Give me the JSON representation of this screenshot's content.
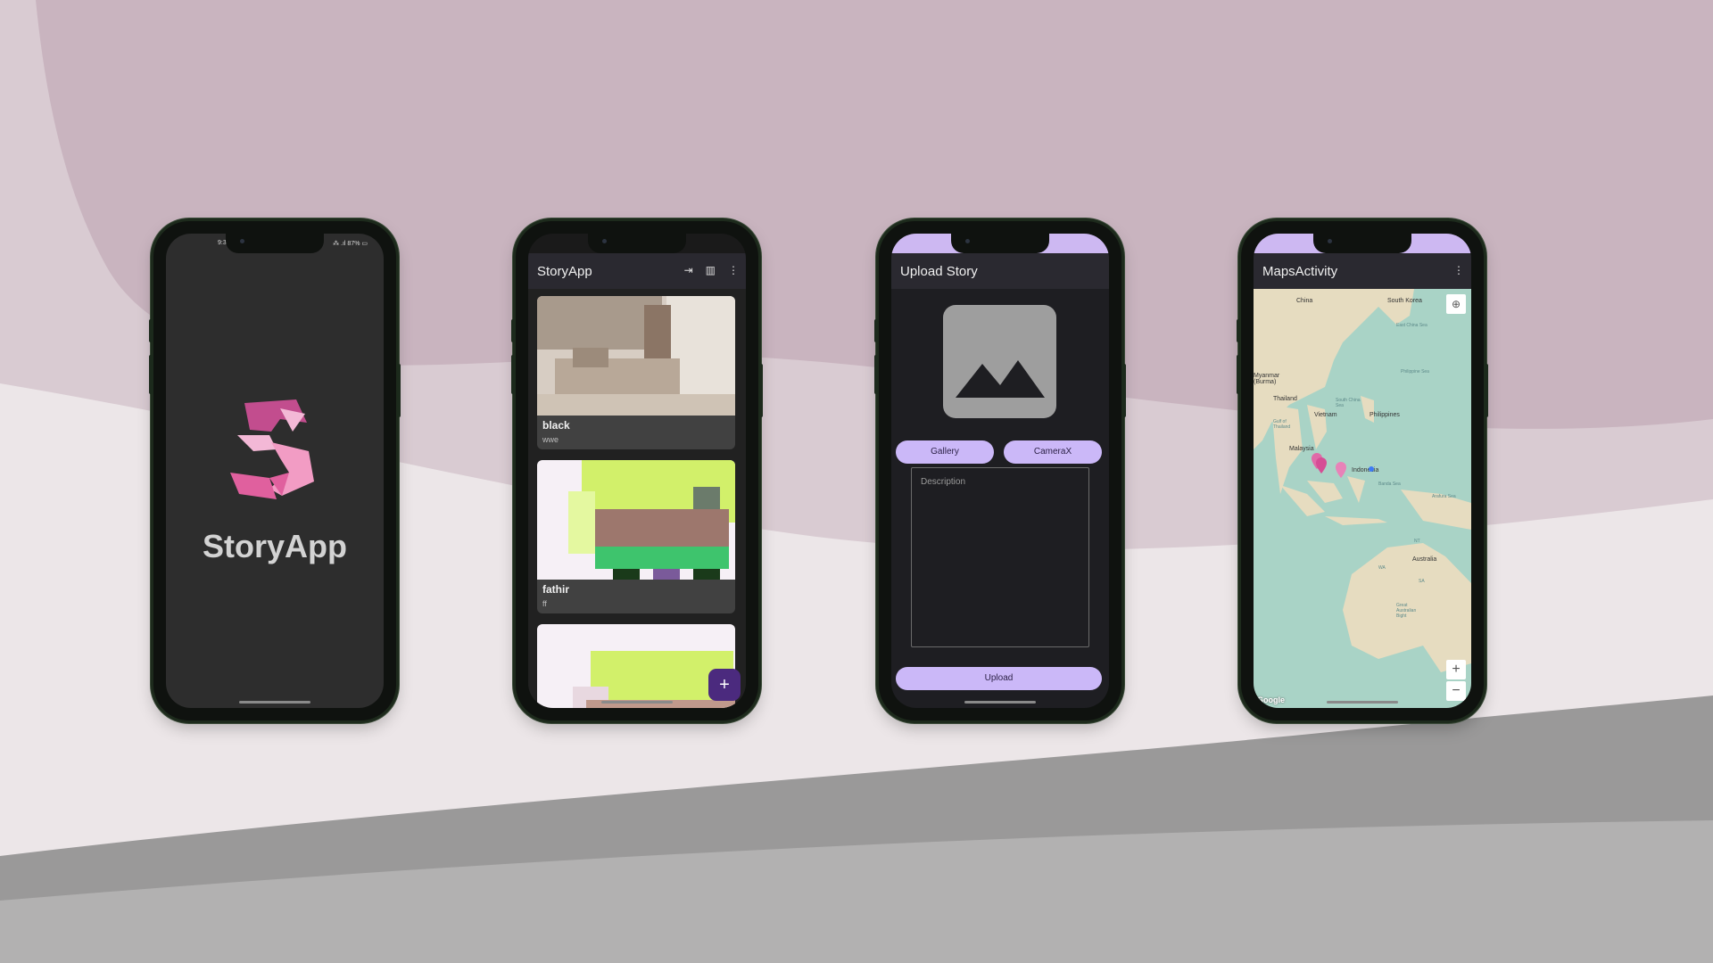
{
  "phones": {
    "splash": {
      "status_time": "9:3.",
      "status_right": "⁂ .ıl 87% ▭",
      "app_name": "StoryApp"
    },
    "list": {
      "title": "StoryApp",
      "stories": [
        {
          "name": "black",
          "description": "wwe"
        },
        {
          "name": "fathir",
          "description": "ff"
        }
      ],
      "fab_label": "+"
    },
    "upload": {
      "title": "Upload Story",
      "gallery_label": "Gallery",
      "camerax_label": "CameraX",
      "description_placeholder": "Description",
      "upload_label": "Upload"
    },
    "maps": {
      "title": "MapsActivity",
      "labels": {
        "china": "China",
        "south_korea": "South Korea",
        "east_china_sea": "East China Sea",
        "myanmar": "Myanmar (Burma)",
        "thailand": "Thailand",
        "vietnam": "Vietnam",
        "philippines": "Philippines",
        "philippine_sea": "Philippine Sea",
        "south_china_sea": "South China Sea",
        "gulf_of_thailand": "Gulf of Thailand",
        "malaysia": "Malaysia",
        "indonesia": "Indonesia",
        "banda_sea": "Banda Sea",
        "arafura_sea": "Arafura Sea",
        "nt": "NT",
        "wa": "WA",
        "sa": "SA",
        "australia": "Australia",
        "great_australian_bight": "Great Australian Bight"
      },
      "zoom_in": "+",
      "zoom_out": "−",
      "attribution": "Google"
    }
  },
  "colors": {
    "accent_purple": "#cbb8f8",
    "fab_purple": "#4b2a7e",
    "logo_pink": "#e0609e"
  }
}
